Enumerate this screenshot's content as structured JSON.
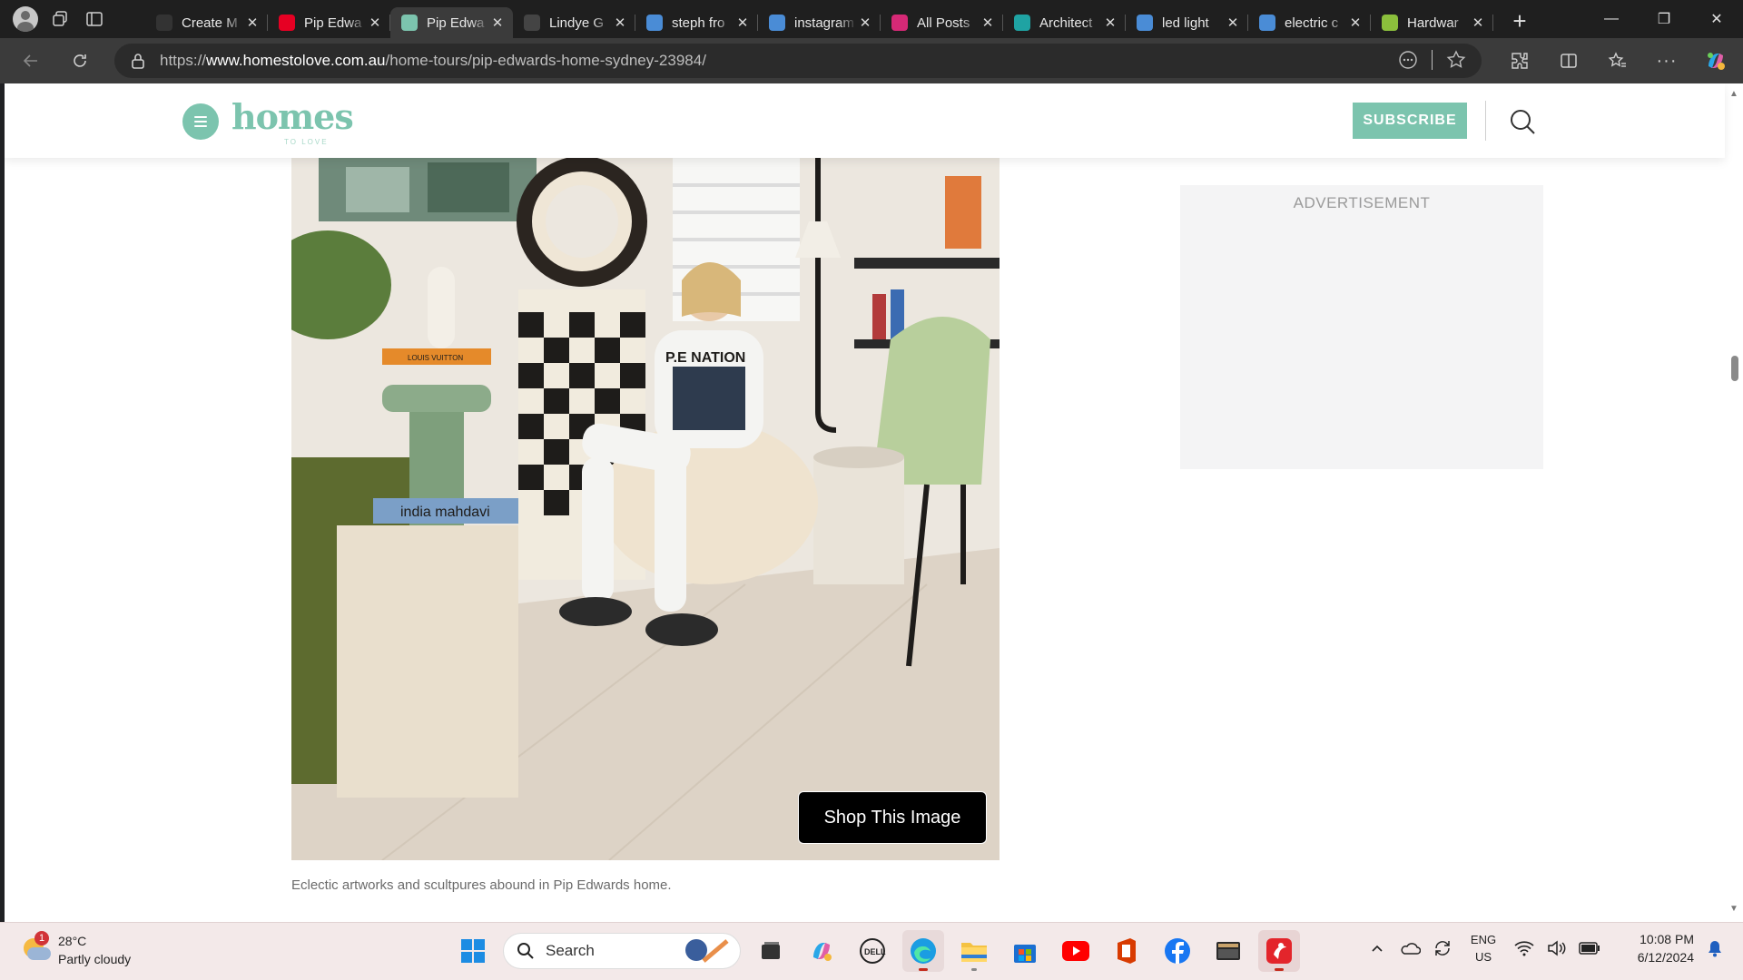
{
  "browser": {
    "tabs": [
      {
        "title": "Create M",
        "icon": "document-icon",
        "color": "#333333",
        "active": false
      },
      {
        "title": "Pip Edwa",
        "icon": "pinterest-icon",
        "color": "#e60023",
        "active": false
      },
      {
        "title": "Pip Edwa",
        "icon": "homes-h-icon",
        "color": "#7cc4ae",
        "active": true
      },
      {
        "title": "Lindye G",
        "icon": "site-icon",
        "color": "#444444",
        "active": false
      },
      {
        "title": "steph fro",
        "icon": "search-icon",
        "color": "#4a8cd6",
        "active": false
      },
      {
        "title": "instagram",
        "icon": "search-icon",
        "color": "#4a8cd6",
        "active": false
      },
      {
        "title": "All Posts",
        "icon": "instagram-icon",
        "color": "#d62976",
        "active": false
      },
      {
        "title": "Architect",
        "icon": "architect-a-icon",
        "color": "#1fa3a3",
        "active": false
      },
      {
        "title": "led light",
        "icon": "search-icon",
        "color": "#4a8cd6",
        "active": false
      },
      {
        "title": "electric c",
        "icon": "search-icon",
        "color": "#4a8cd6",
        "active": false
      },
      {
        "title": "Hardwar",
        "icon": "leaf-icon",
        "color": "#8bbf3c",
        "active": false
      }
    ],
    "url_prefix": "https://",
    "url_host": "www.homestolove.com.au",
    "url_path": "/home-tours/pip-edwards-home-sydney-23984/"
  },
  "site": {
    "logo_text": "homes",
    "logo_sub": "TO LOVE",
    "subscribe_label": "SUBSCRIBE",
    "brand_color": "#7cc4ae"
  },
  "article": {
    "shop_button_label": "Shop This Image",
    "caption": "Eclectic artworks and scultpures abound in Pip Edwards home.",
    "photo_book_1": "LOUIS VUITTON",
    "photo_book_2": "india mahdavi",
    "photo_shirt": "P.E NATION"
  },
  "sidebar": {
    "ad_label": "ADVERTISEMENT"
  },
  "taskbar": {
    "weather_badge": "1",
    "temperature": "28°C",
    "condition": "Partly cloudy",
    "search_label": "Search",
    "language": "ENG",
    "region": "US",
    "time": "10:08 PM",
    "date": "6/12/2024"
  }
}
